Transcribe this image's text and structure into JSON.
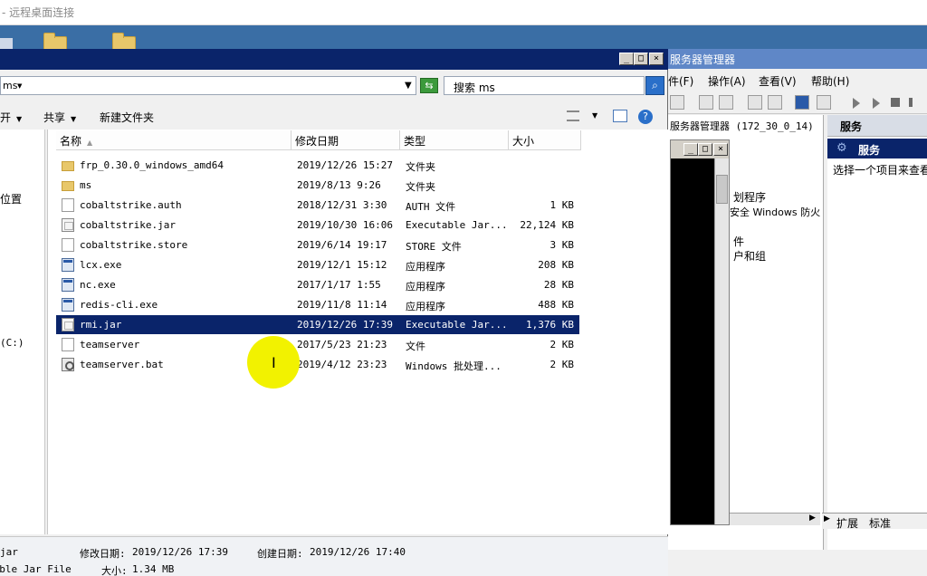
{
  "rdp": {
    "title": "- 远程桌面连接"
  },
  "explorer": {
    "address": "ms",
    "search_placeholder": "搜索 ms",
    "toolbar": {
      "organize": "开",
      "share": "共享",
      "new_folder": "新建文件夹"
    },
    "nav": {
      "location": "位置",
      "drive": "(C:)"
    },
    "columns": {
      "name": "名称",
      "date": "修改日期",
      "type": "类型",
      "size": "大小"
    },
    "files": [
      {
        "name": "frp_0.30.0_windows_amd64",
        "date": "2019/12/26 15:27",
        "type": "文件夹",
        "size": "",
        "icon": "folder"
      },
      {
        "name": "ms",
        "date": "2019/8/13 9:26",
        "type": "文件夹",
        "size": "",
        "icon": "folder"
      },
      {
        "name": "cobaltstrike.auth",
        "date": "2018/12/31 3:30",
        "type": "AUTH 文件",
        "size": "1 KB",
        "icon": "doc"
      },
      {
        "name": "cobaltstrike.jar",
        "date": "2019/10/30 16:06",
        "type": "Executable Jar...",
        "size": "22,124 KB",
        "icon": "jar"
      },
      {
        "name": "cobaltstrike.store",
        "date": "2019/6/14 19:17",
        "type": "STORE 文件",
        "size": "3 KB",
        "icon": "doc"
      },
      {
        "name": "lcx.exe",
        "date": "2019/12/1 15:12",
        "type": "应用程序",
        "size": "208 KB",
        "icon": "exe"
      },
      {
        "name": "nc.exe",
        "date": "2017/1/17 1:55",
        "type": "应用程序",
        "size": "28 KB",
        "icon": "exe"
      },
      {
        "name": "redis-cli.exe",
        "date": "2019/11/8 11:14",
        "type": "应用程序",
        "size": "488 KB",
        "icon": "exe"
      },
      {
        "name": "rmi.jar",
        "date": "2019/12/26 17:39",
        "type": "Executable Jar...",
        "size": "1,376 KB",
        "icon": "jar",
        "selected": true
      },
      {
        "name": "teamserver",
        "date": "2017/5/23 21:23",
        "type": "文件",
        "size": "2 KB",
        "icon": "doc"
      },
      {
        "name": "teamserver.bat",
        "date": "2019/4/12 23:23",
        "type": "Windows 批处理...",
        "size": "2 KB",
        "icon": "bat"
      }
    ],
    "details": {
      "name": "jar",
      "modified_label": "修改日期:",
      "modified": "2019/12/26 17:39",
      "created_label": "创建日期:",
      "created": "2019/12/26 17:40",
      "type": "table Jar File",
      "size_label": "大小:",
      "size": "1.34 MB"
    }
  },
  "server_manager": {
    "title": "服务器管理器",
    "menu": [
      "件(F)",
      "操作(A)",
      "查看(V)",
      "帮助(H)"
    ],
    "tree": {
      "root": "服务器管理器 (172_30_0_14)",
      "item1": "划程序",
      "item2": "安全 Windows 防火",
      "item3": "件",
      "item4": "户和组"
    },
    "right_header": "服务",
    "services_label": "服务",
    "hint": "选择一个项目来查看",
    "tabs": {
      "extended": "扩展",
      "standard": "标准"
    }
  },
  "colors": {
    "selection": "#0a246a",
    "desktop": "#3a6ea5",
    "highlight": "#f2f200"
  }
}
